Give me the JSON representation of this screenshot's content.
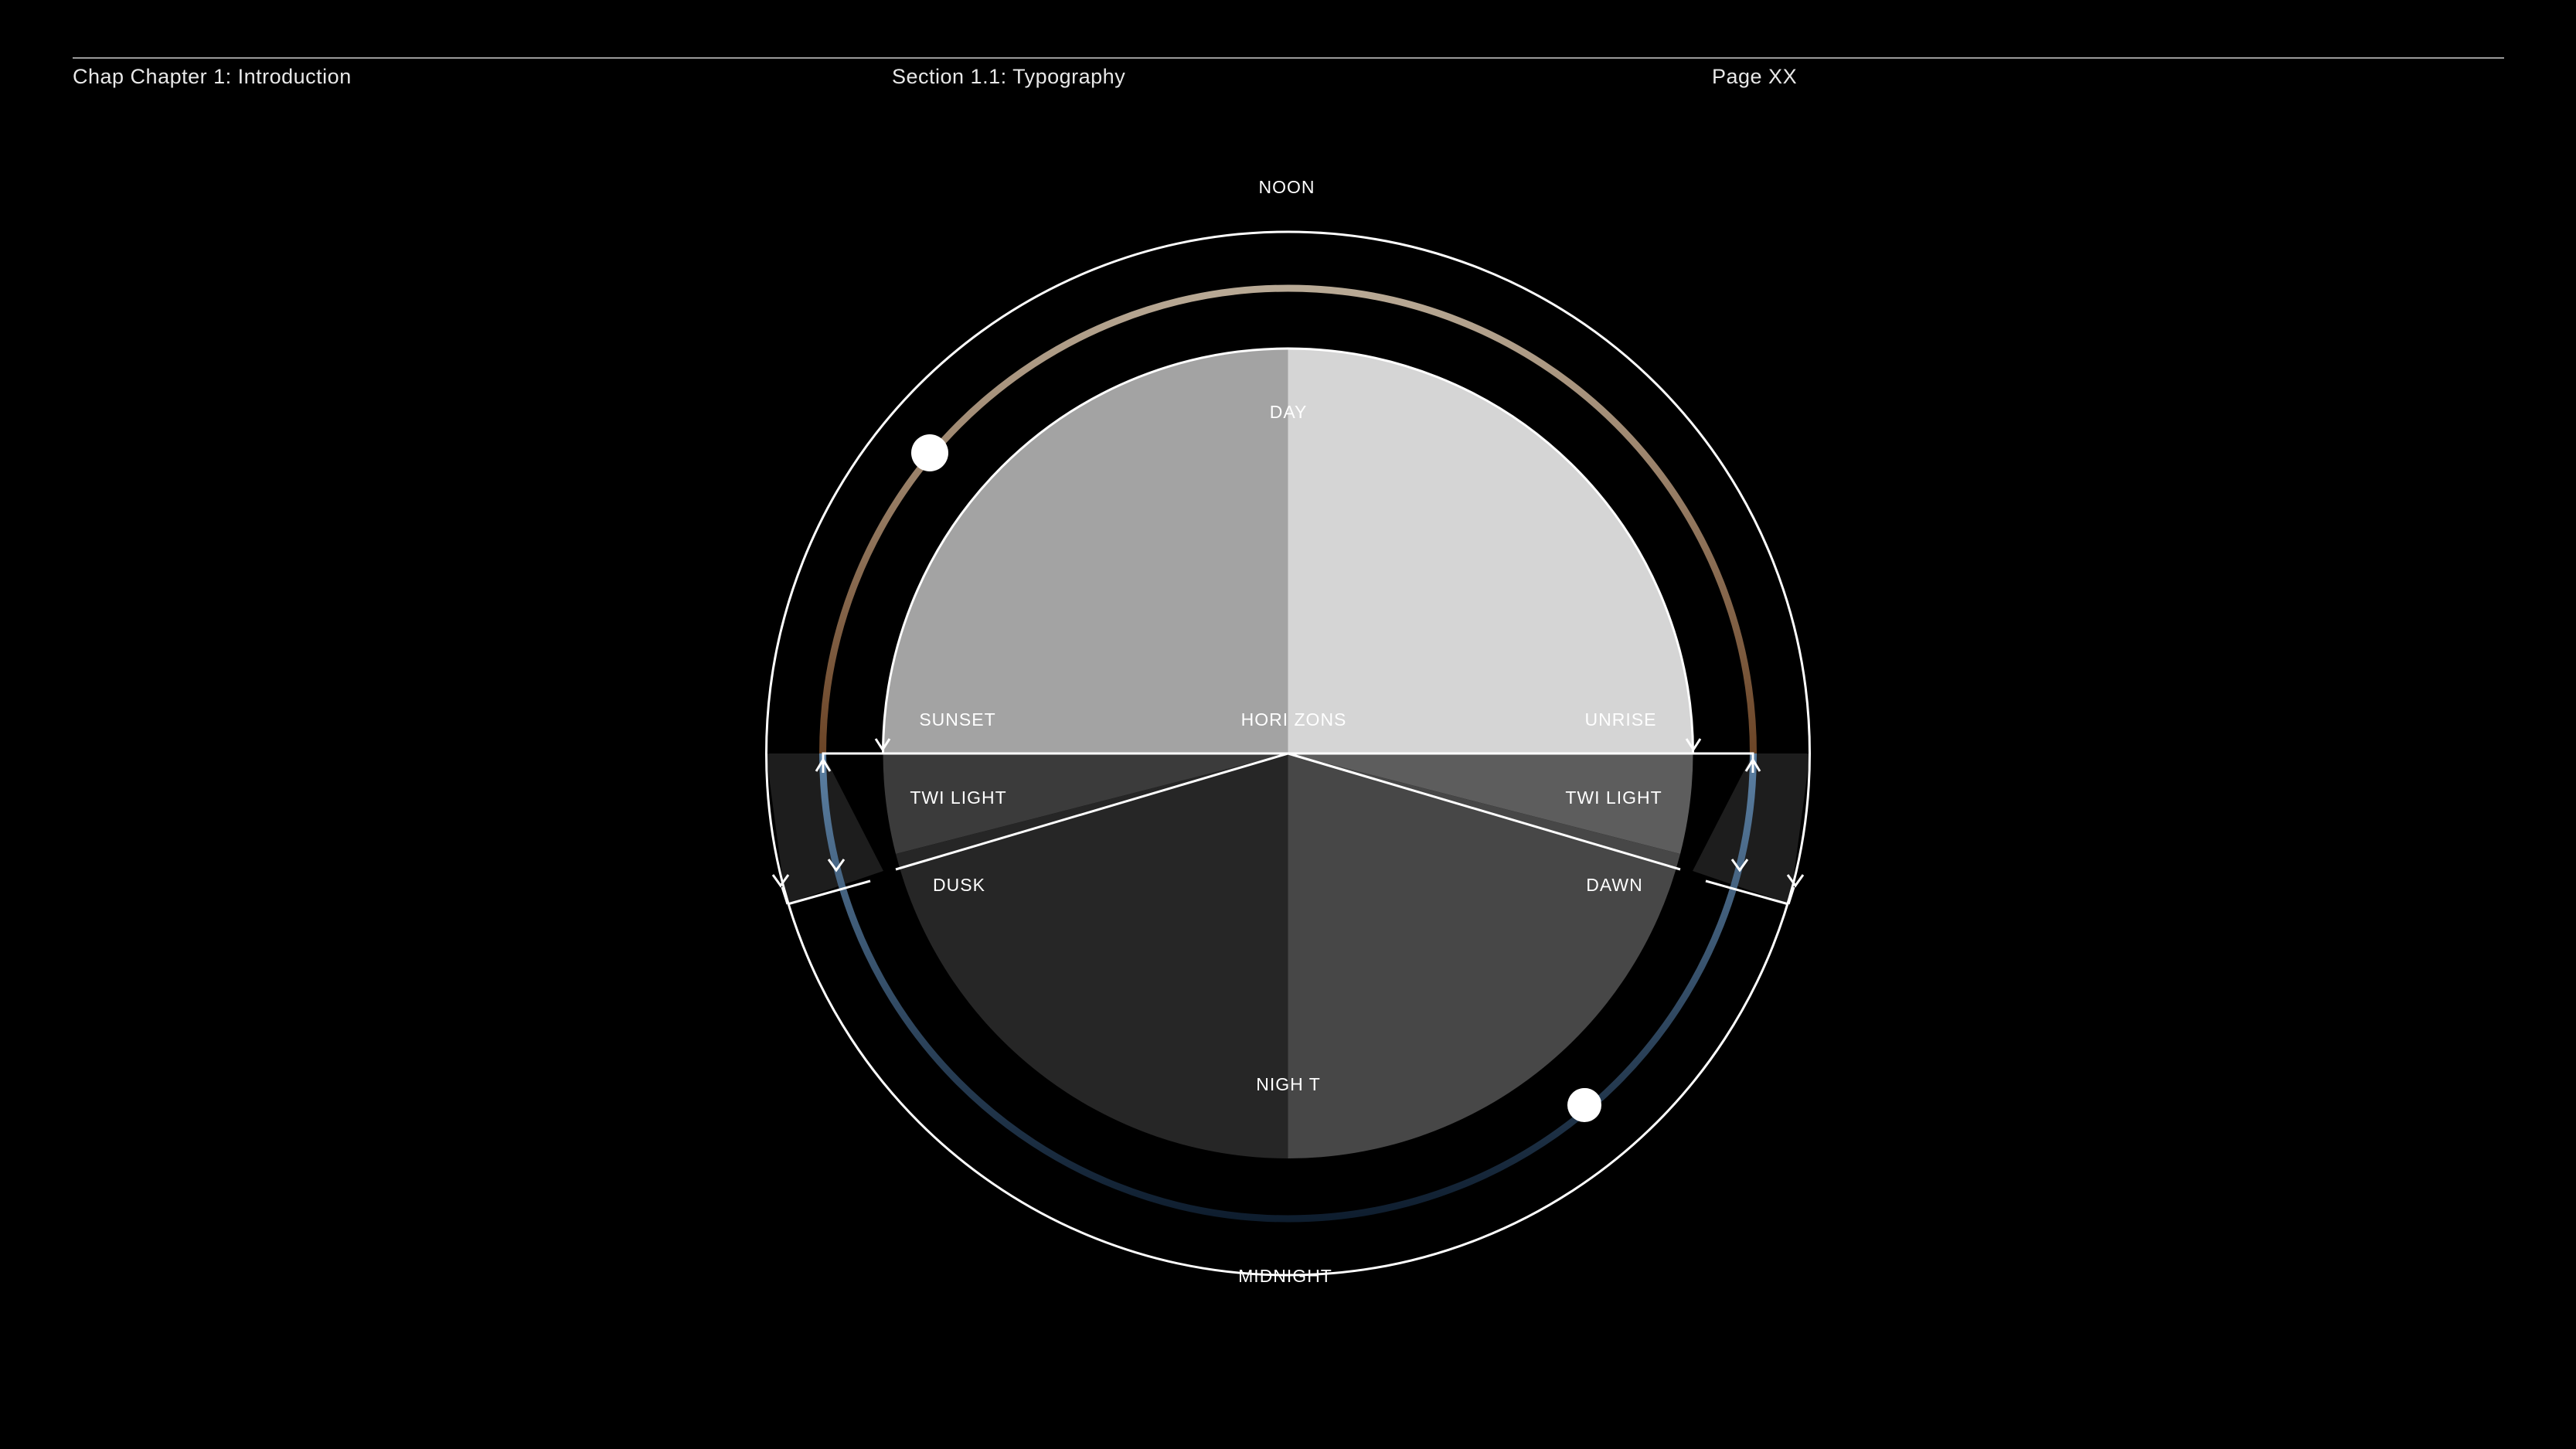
{
  "header": {
    "chapter": "Chap Chapter 1: Introduction",
    "section": "Section 1.1: Typography",
    "page": "Page XX"
  },
  "diagram": {
    "outer_labels": {
      "top": "NOON",
      "bottom": "MIDNIGHT"
    },
    "segments": {
      "day": "DAY",
      "night": "NIGH T",
      "horizons": "HORI ZONS",
      "sunset": "SUNSET",
      "sunrise": "UNRISE",
      "twilight_left": "TWI LIGHT",
      "twilight_right": "TWI LIGHT",
      "dusk": "DUSK",
      "dawn": "DAWN"
    },
    "colors": {
      "day_left": "#a3a3a3",
      "day_right": "#d5d5d5",
      "twilight_left": "#3b3b3b",
      "twilight_right": "#5d5d5d",
      "night_left": "#262626",
      "night_right": "#474747",
      "day_arc_top": "#b9aa96",
      "day_arc_side": "#6b4426",
      "night_arc_side": "#5c80a3",
      "night_arc_bottom": "#0e1d2e",
      "band": "#1d1d1d"
    },
    "markers": [
      {
        "name": "sun-marker",
        "glyph": "circle"
      },
      {
        "name": "moon-marker",
        "glyph": "half-circle"
      }
    ]
  }
}
